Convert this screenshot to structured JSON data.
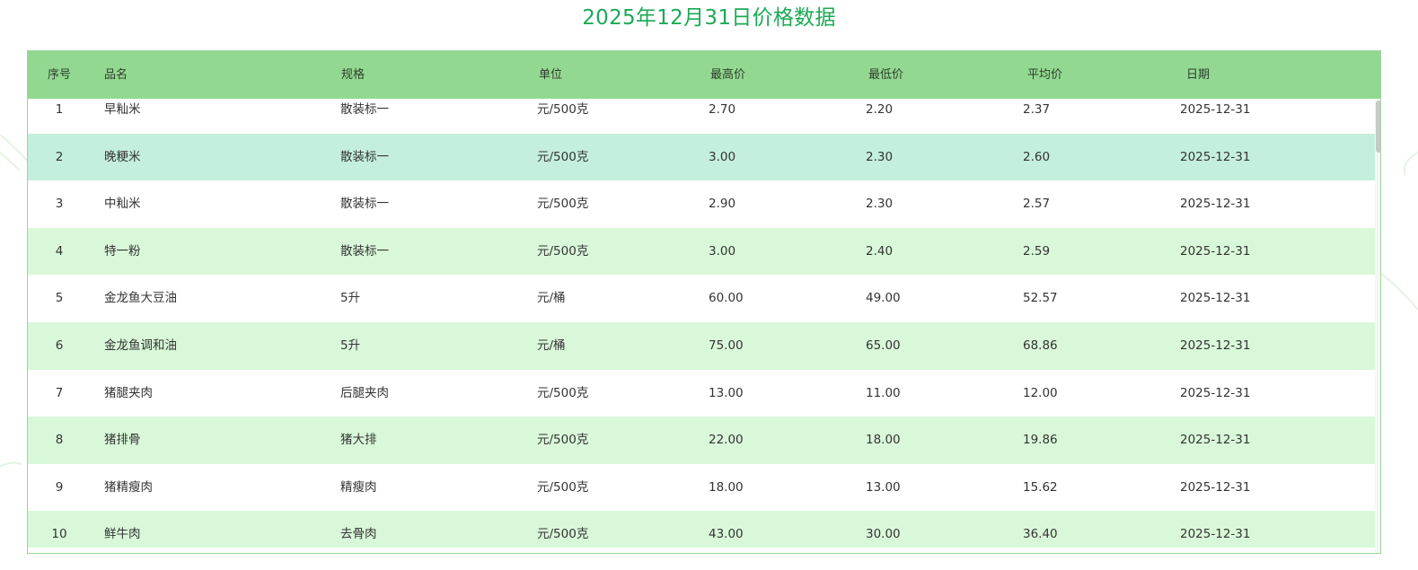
{
  "title": "2025年12月31日价格数据",
  "colors": {
    "title": "#1aaa55",
    "header_bg": "#93d891",
    "row_alt_bg": "#d9f8d9",
    "row_highlight_bg": "#c4efdc",
    "border": "#9ad69a"
  },
  "table": {
    "columns": [
      "序号",
      "品名",
      "规格",
      "单位",
      "最高价",
      "最低价",
      "平均价",
      "日期"
    ],
    "rows": [
      [
        "1",
        "早籼米",
        "散装标一",
        "元/500克",
        "2.70",
        "2.20",
        "2.37",
        "2025-12-31"
      ],
      [
        "2",
        "晚粳米",
        "散装标一",
        "元/500克",
        "3.00",
        "2.30",
        "2.60",
        "2025-12-31"
      ],
      [
        "3",
        "中籼米",
        "散装标一",
        "元/500克",
        "2.90",
        "2.30",
        "2.57",
        "2025-12-31"
      ],
      [
        "4",
        "特一粉",
        "散装标一",
        "元/500克",
        "3.00",
        "2.40",
        "2.59",
        "2025-12-31"
      ],
      [
        "5",
        "金龙鱼大豆油",
        "5升",
        "元/桶",
        "60.00",
        "49.00",
        "52.57",
        "2025-12-31"
      ],
      [
        "6",
        "金龙鱼调和油",
        "5升",
        "元/桶",
        "75.00",
        "65.00",
        "68.86",
        "2025-12-31"
      ],
      [
        "7",
        "猪腿夹肉",
        "后腿夹肉",
        "元/500克",
        "13.00",
        "11.00",
        "12.00",
        "2025-12-31"
      ],
      [
        "8",
        "猪排骨",
        "猪大排",
        "元/500克",
        "22.00",
        "18.00",
        "19.86",
        "2025-12-31"
      ],
      [
        "9",
        "猪精瘦肉",
        "精瘦肉",
        "元/500克",
        "18.00",
        "13.00",
        "15.62",
        "2025-12-31"
      ],
      [
        "10",
        "鲜牛肉",
        "去骨肉",
        "元/500克",
        "43.00",
        "30.00",
        "36.40",
        "2025-12-31"
      ]
    ],
    "highlighted_row": 1
  }
}
